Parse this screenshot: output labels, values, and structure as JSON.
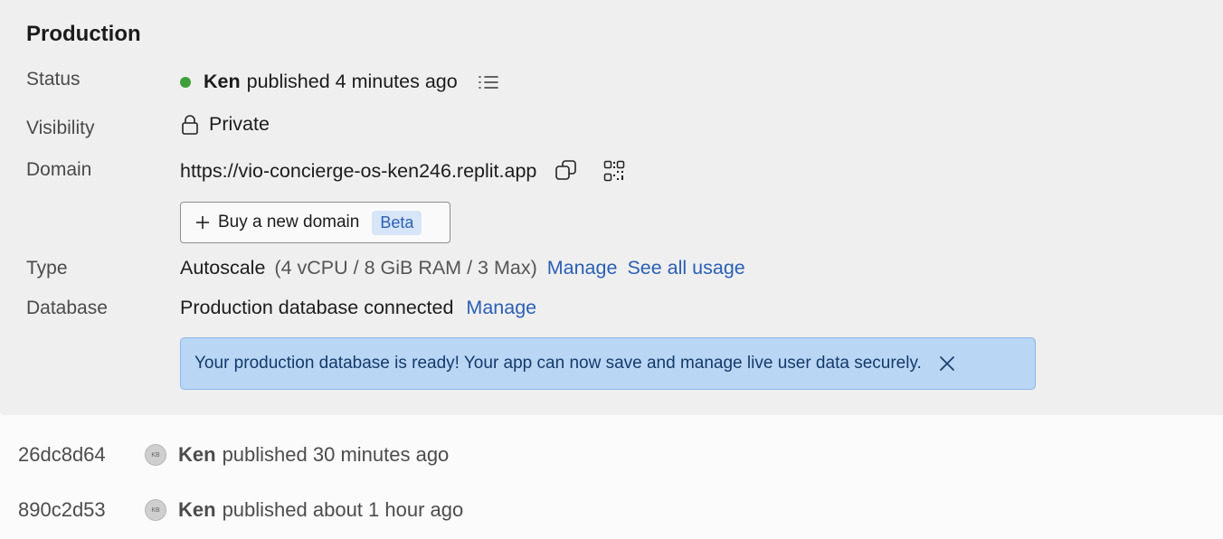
{
  "production": {
    "title": "Production",
    "status": {
      "label": "Status",
      "user": "Ken",
      "text": "published 4 minutes ago",
      "dot_color": "#3f9f3a",
      "icon": "list-icon"
    },
    "visibility": {
      "label": "Visibility",
      "value": "Private",
      "icon": "lock-icon"
    },
    "domain": {
      "label": "Domain",
      "url": "https://vio-concierge-os-ken246.replit.app",
      "copy_icon": "copy-icon",
      "qr_icon": "qr-code-icon",
      "buy_button": "Buy a new domain",
      "badge": "Beta"
    },
    "type": {
      "label": "Type",
      "value": "Autoscale",
      "spec": "(4 vCPU / 8 GiB RAM / 3 Max)",
      "manage_link": "Manage",
      "usage_link": "See all usage"
    },
    "database": {
      "label": "Database",
      "value": "Production database connected",
      "manage_link": "Manage"
    },
    "alert": {
      "message": "Your production database is ready! Your app can now save and manage live user data securely."
    }
  },
  "history": [
    {
      "hash": "26dc8d64",
      "initials": "KB",
      "user": "Ken",
      "text": "published 30 minutes ago"
    },
    {
      "hash": "890c2d53",
      "initials": "KB",
      "user": "Ken",
      "text": "published about 1 hour ago"
    }
  ]
}
